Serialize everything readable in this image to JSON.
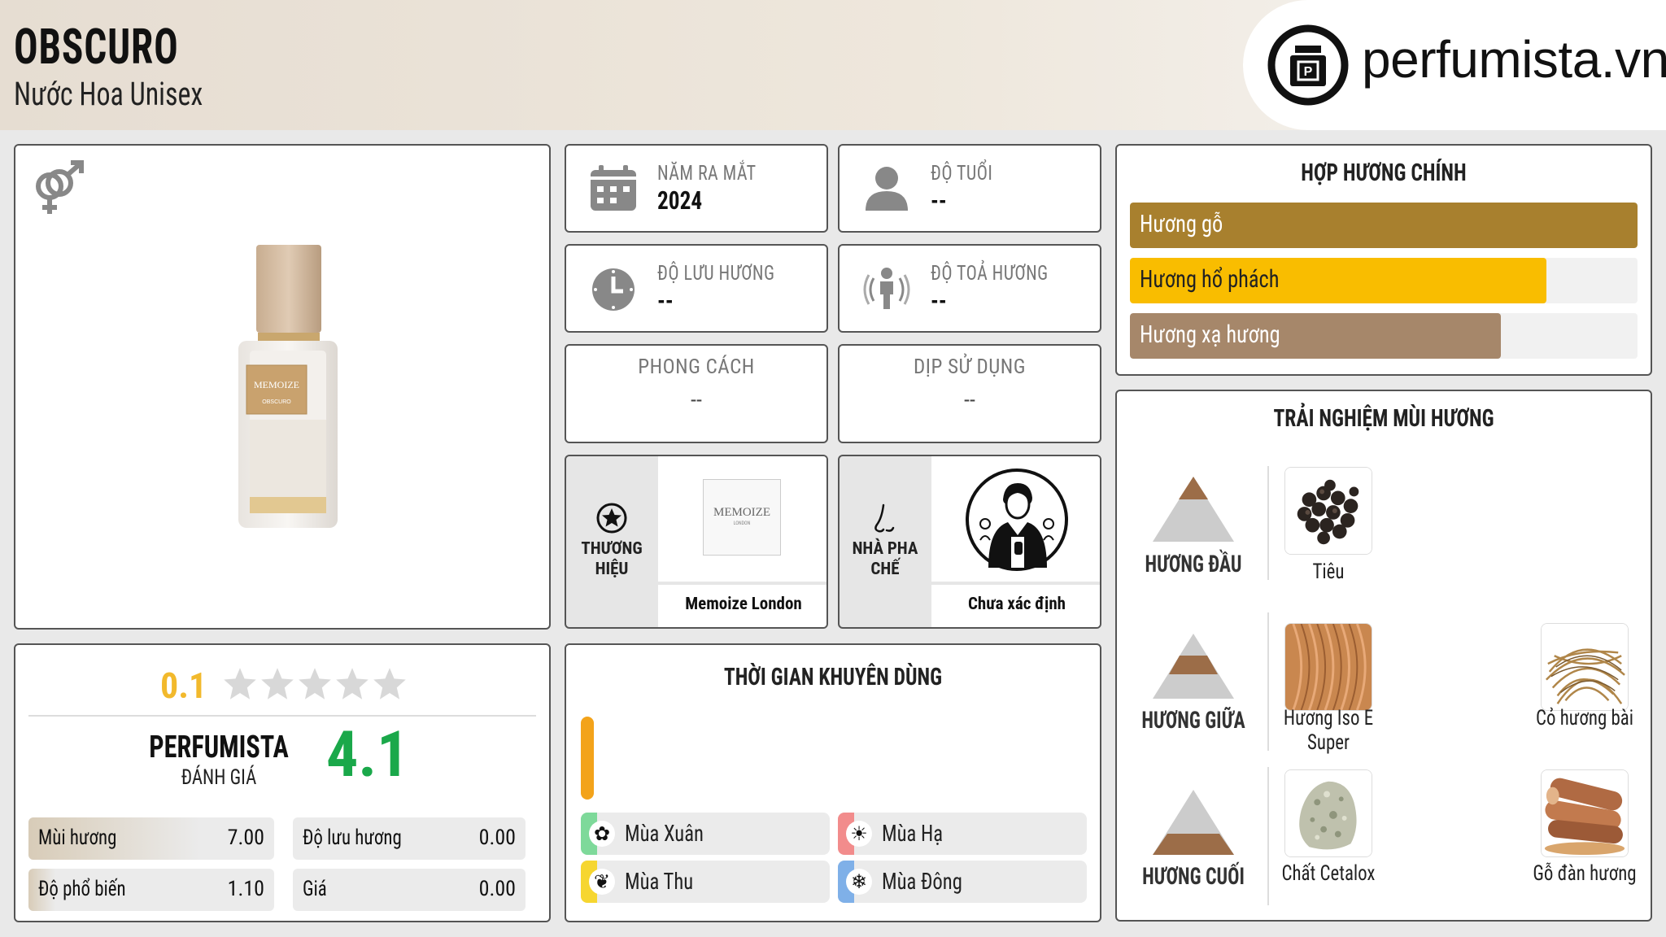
{
  "header": {
    "title": "OBSCURO",
    "subtitle": "Nước Hoa Unisex",
    "logo_text": "perfumista.vn"
  },
  "product": {
    "gender_icon": "unisex-gender-icon",
    "bottle_label": "MEMOIZE",
    "bottle_sub": "OBSCURO"
  },
  "stats": {
    "launch_year": {
      "label": "NĂM RA MẮT",
      "value": "2024",
      "icon": "calendar-icon"
    },
    "age": {
      "label": "ĐỘ TUỔI",
      "value": "--",
      "icon": "user-icon"
    },
    "longevity": {
      "label": "ĐỘ LƯU HƯƠNG",
      "value": "--",
      "icon": "clock-icon"
    },
    "sillage": {
      "label": "ĐỘ TOẢ HƯƠNG",
      "value": "--",
      "icon": "sillage-icon"
    },
    "style": {
      "label": "PHONG CÁCH",
      "value": "--"
    },
    "occasion": {
      "label": "DỊP SỬ DỤNG",
      "value": "--"
    }
  },
  "brand": {
    "label": "THƯƠNG HIỆU",
    "name": "Memoize London",
    "logo_text": "MEMOIZE",
    "logo_sub": "LONDON"
  },
  "perfumer": {
    "label": "NHÀ PHA CHẾ",
    "name": "Chưa xác định"
  },
  "accords": {
    "title": "HỢP HƯƠNG CHÍNH",
    "items": [
      {
        "label": "Hương gỗ",
        "percent": 100,
        "color": "#a8802e"
      },
      {
        "label": "Hương hổ phách",
        "percent": 82,
        "color": "#f9bd00"
      },
      {
        "label": "Hương xạ hương",
        "percent": 73,
        "color": "#a6876a"
      }
    ]
  },
  "rating": {
    "user_score": "0.1",
    "stars_filled": 0,
    "brand_label": "PERFUMISTA",
    "brand_sub": "ĐÁNH GIÁ",
    "brand_score": "4.1",
    "scores": [
      {
        "label": "Mùi hương",
        "value": "7.00",
        "fill": 0.7
      },
      {
        "label": "Độ lưu hương",
        "value": "0.00",
        "fill": 0
      },
      {
        "label": "Độ phổ biến",
        "value": "1.10",
        "fill": 0.11
      },
      {
        "label": "Giá",
        "value": "0.00",
        "fill": 0
      }
    ]
  },
  "usage_time": {
    "title": "THỜI GIAN KHUYÊN DÙNG",
    "seasons": [
      {
        "label": "Mùa Xuân",
        "color": "#7ed99a",
        "icon": "flower-icon"
      },
      {
        "label": "Mùa Hạ",
        "color": "#f28c8c",
        "icon": "sun-icon"
      },
      {
        "label": "Mùa Thu",
        "color": "#f6d630",
        "icon": "leaf-icon"
      },
      {
        "label": "Mùa Đông",
        "color": "#7fb0e8",
        "icon": "snowflake-icon"
      }
    ]
  },
  "notes": {
    "title": "TRẢI NGHIỆM MÙI HƯƠNG",
    "top": {
      "label": "HƯƠNG ĐẦU",
      "items": [
        "Tiêu"
      ]
    },
    "middle": {
      "label": "HƯƠNG GIỮA",
      "items": [
        "Hương Iso E Super",
        "Cỏ hương bài"
      ]
    },
    "base": {
      "label": "HƯƠNG CUỐI",
      "items": [
        "Chất Cetalox",
        "Gỗ đàn hương"
      ]
    }
  }
}
